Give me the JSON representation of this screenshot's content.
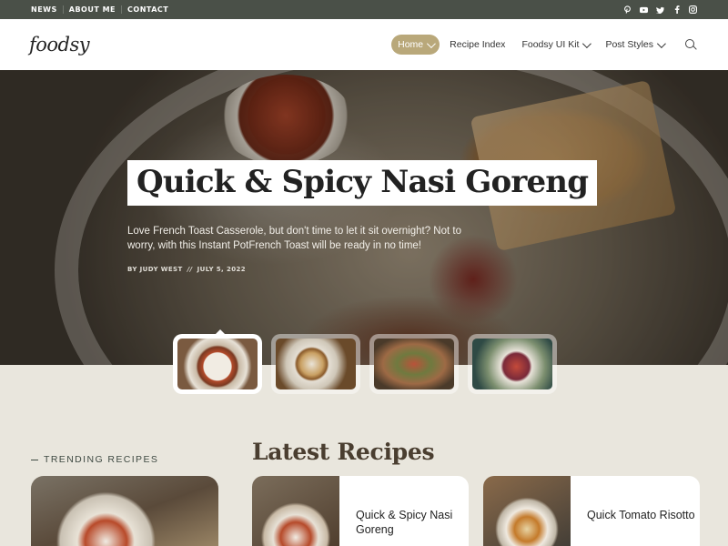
{
  "topbar": {
    "links": [
      "NEWS",
      "ABOUT ME",
      "CONTACT"
    ],
    "social": [
      "pinterest-icon",
      "youtube-icon",
      "twitter-icon",
      "facebook-icon",
      "instagram-icon"
    ]
  },
  "header": {
    "logo": "foodsy",
    "nav": [
      {
        "label": "Home",
        "active": true,
        "dropdown": true
      },
      {
        "label": "Recipe Index",
        "active": false,
        "dropdown": false
      },
      {
        "label": "Foodsy UI Kit",
        "active": false,
        "dropdown": true
      },
      {
        "label": "Post Styles",
        "active": false,
        "dropdown": true
      }
    ]
  },
  "hero": {
    "title": "Quick & Spicy Nasi Goreng",
    "description": "Love French Toast Casserole, but don't time to let it sit overnight? Not to worry, with this Instant PotFrench Toast will be ready in no time!",
    "author": "BY JUDY WEST",
    "separator": "//",
    "date": "JULY 5, 2022"
  },
  "sections": {
    "trending": "TRENDING RECIPES",
    "latest": "Latest Recipes"
  },
  "latest_recipes": [
    {
      "title": "Quick & Spicy Nasi Goreng"
    },
    {
      "title": "Quick Tomato Risotto"
    }
  ],
  "colors": {
    "topbar": "#4a5048",
    "accent": "#b9a87a",
    "section_bg": "#e9e6dd",
    "heading": "#4a3e30"
  }
}
